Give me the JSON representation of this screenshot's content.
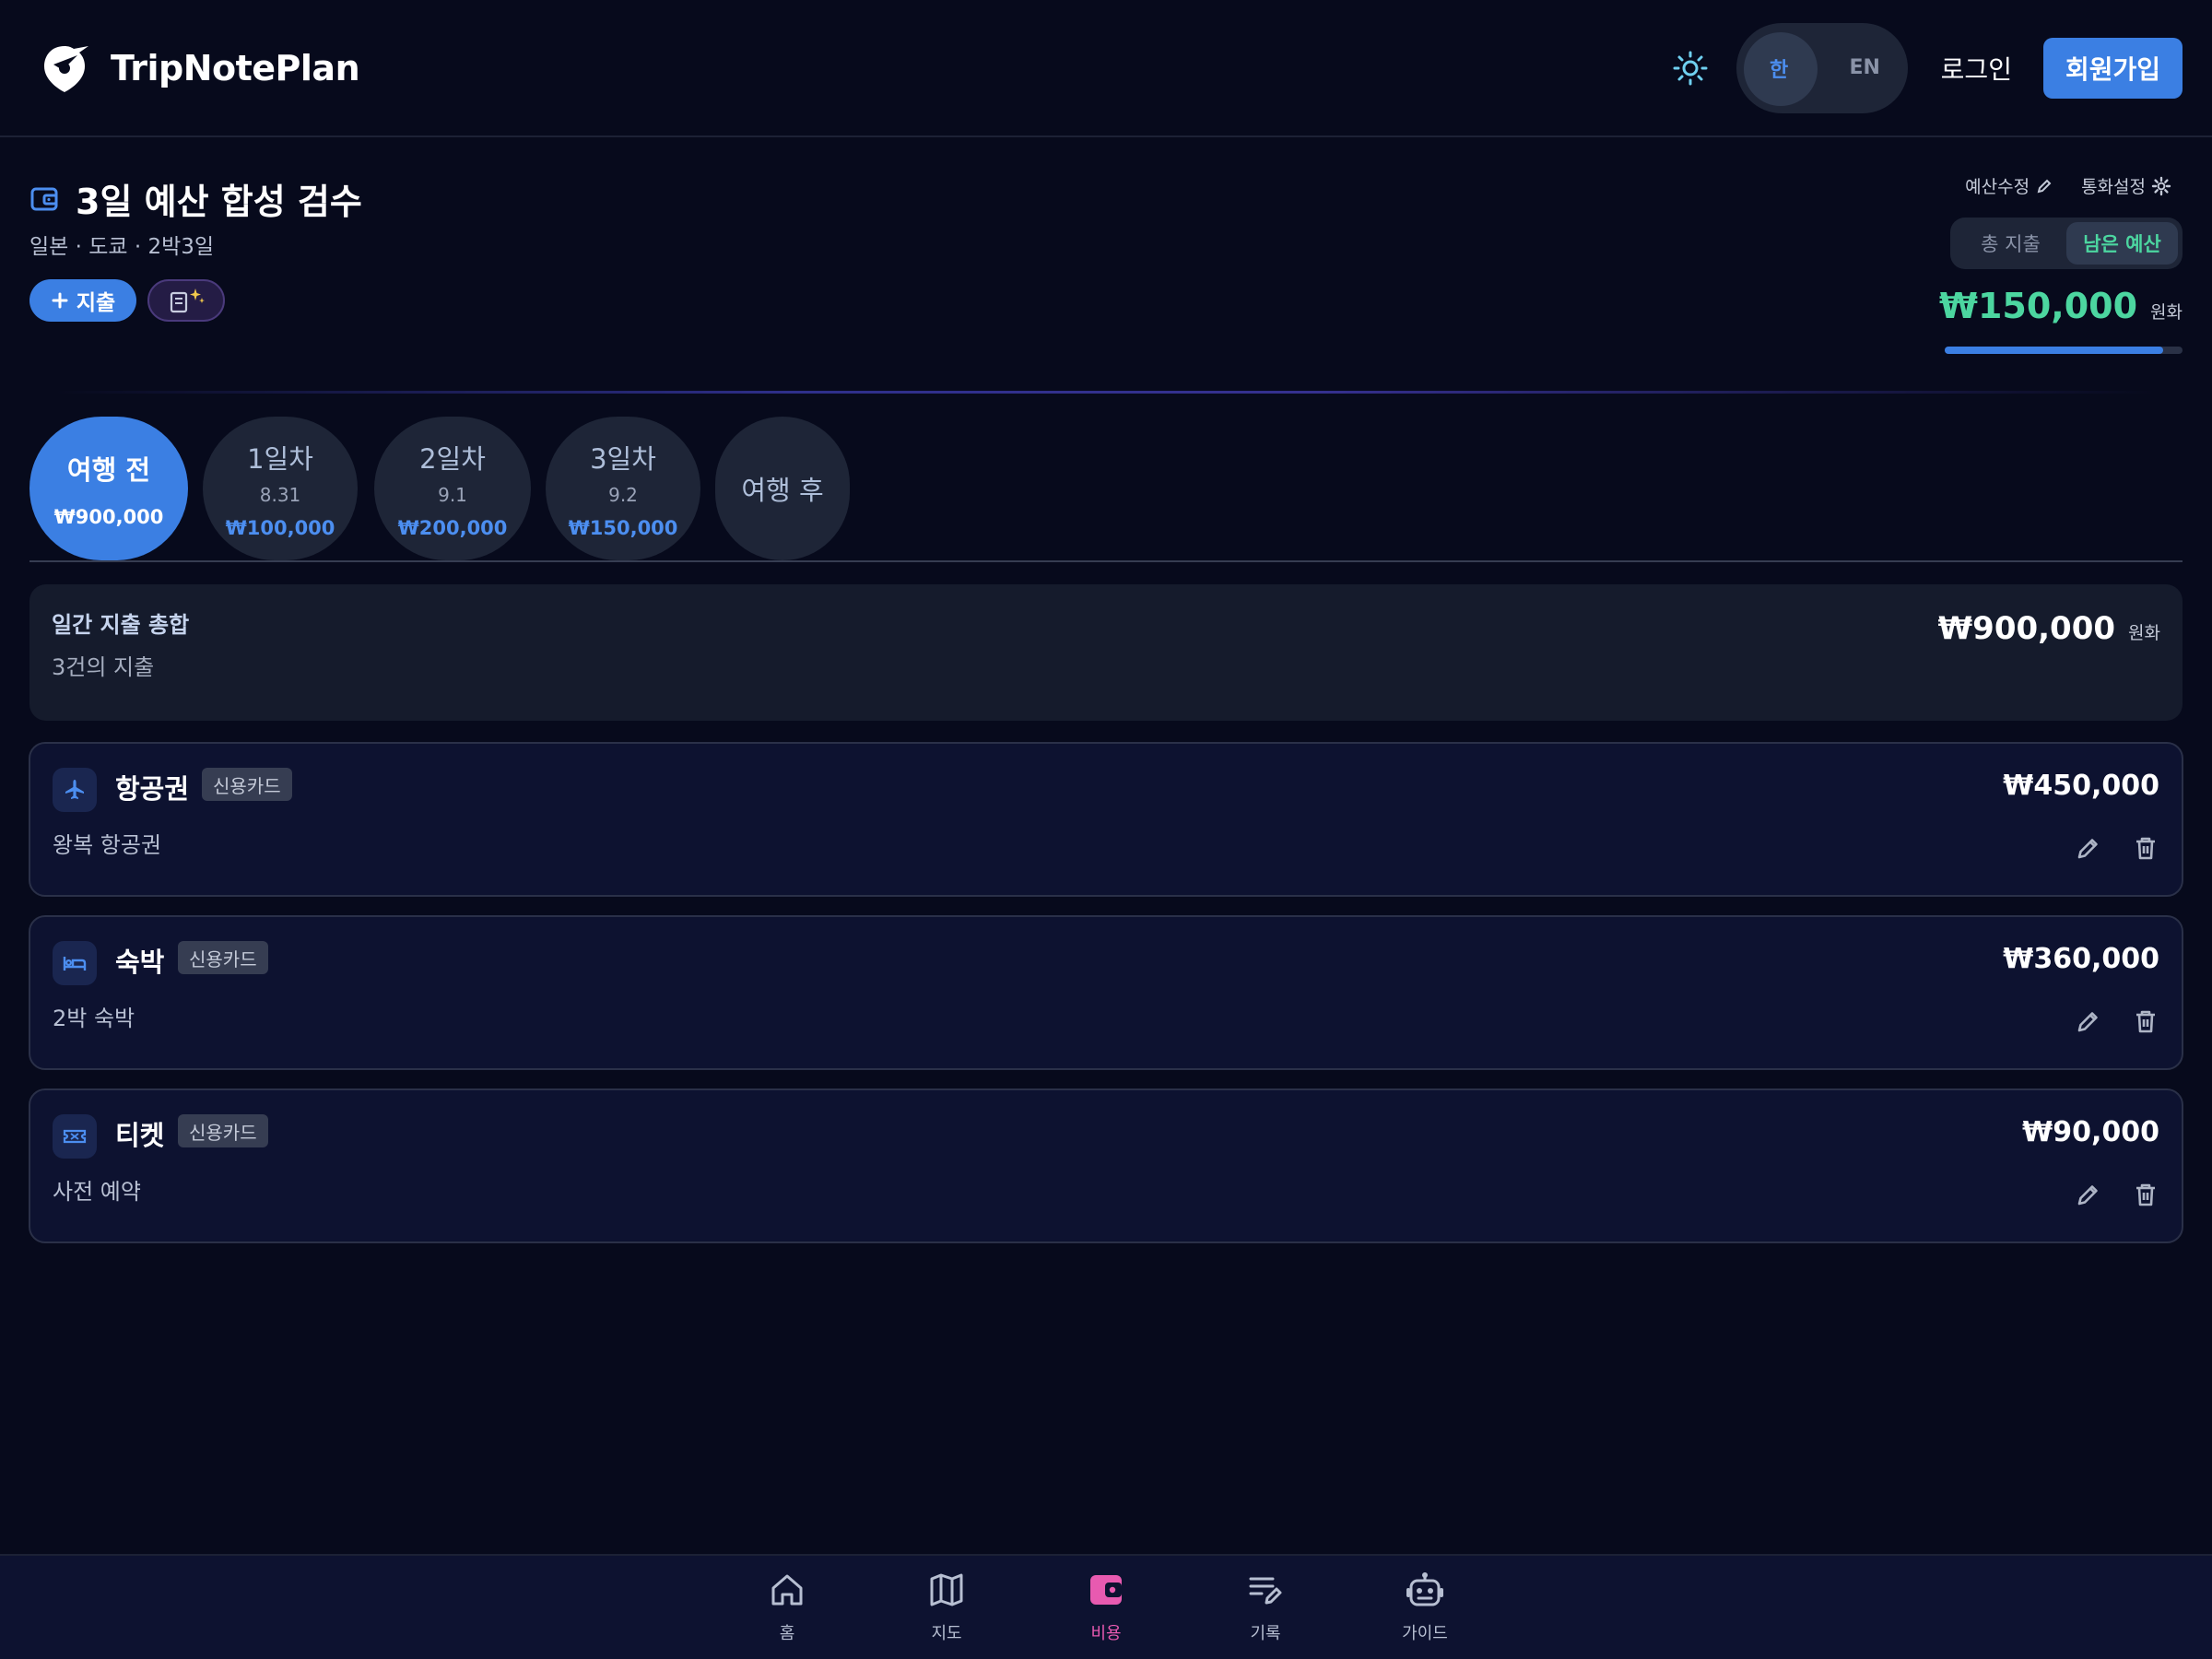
{
  "app": {
    "name": "TripNotePlan"
  },
  "header": {
    "lang_ko": "한",
    "lang_en": "EN",
    "login": "로그인",
    "signup": "회원가입"
  },
  "trip": {
    "title": "3일 예산 합성 검수",
    "subtitle": "일본 · 도쿄 · 2박3일",
    "add_expense": "지출"
  },
  "budget": {
    "edit_label": "예산수정",
    "currency_label": "통화설정",
    "toggle_total": "총 지출",
    "toggle_remaining": "남은 예산",
    "remaining_value": "₩150,000",
    "currency_unit": "원화",
    "remaining_ratio": 0.92
  },
  "day_tabs": [
    {
      "label": "여행 전",
      "date": "",
      "amount": "₩900,000"
    },
    {
      "label": "1일차",
      "date": "8.31",
      "amount": "₩100,000"
    },
    {
      "label": "2일차",
      "date": "9.1",
      "amount": "₩200,000"
    },
    {
      "label": "3일차",
      "date": "9.2",
      "amount": "₩150,000"
    },
    {
      "label": "여행 후",
      "date": "",
      "amount": ""
    }
  ],
  "summary": {
    "title": "일간 지출 총합",
    "count": "3건의 지출",
    "amount": "₩900,000",
    "unit": "원화"
  },
  "expenses": [
    {
      "name": "항공권",
      "payment": "신용카드",
      "memo": "왕복 항공권",
      "amount": "₩450,000",
      "icon": "airplane-icon"
    },
    {
      "name": "숙박",
      "payment": "신용카드",
      "memo": "2박 숙박",
      "amount": "₩360,000",
      "icon": "bed-icon"
    },
    {
      "name": "티켓",
      "payment": "신용카드",
      "memo": "사전 예약",
      "amount": "₩90,000",
      "icon": "ticket-icon"
    }
  ],
  "nav": [
    {
      "label": "홈",
      "icon": "home-icon"
    },
    {
      "label": "지도",
      "icon": "map-icon"
    },
    {
      "label": "비용",
      "icon": "wallet-icon"
    },
    {
      "label": "기록",
      "icon": "note-icon"
    },
    {
      "label": "가이드",
      "icon": "robot-icon"
    }
  ],
  "colors": {
    "background": "#070a1c",
    "accent": "#3b7fe3",
    "remaining": "#4cd6a0",
    "nav_active": "#e85ab0"
  }
}
